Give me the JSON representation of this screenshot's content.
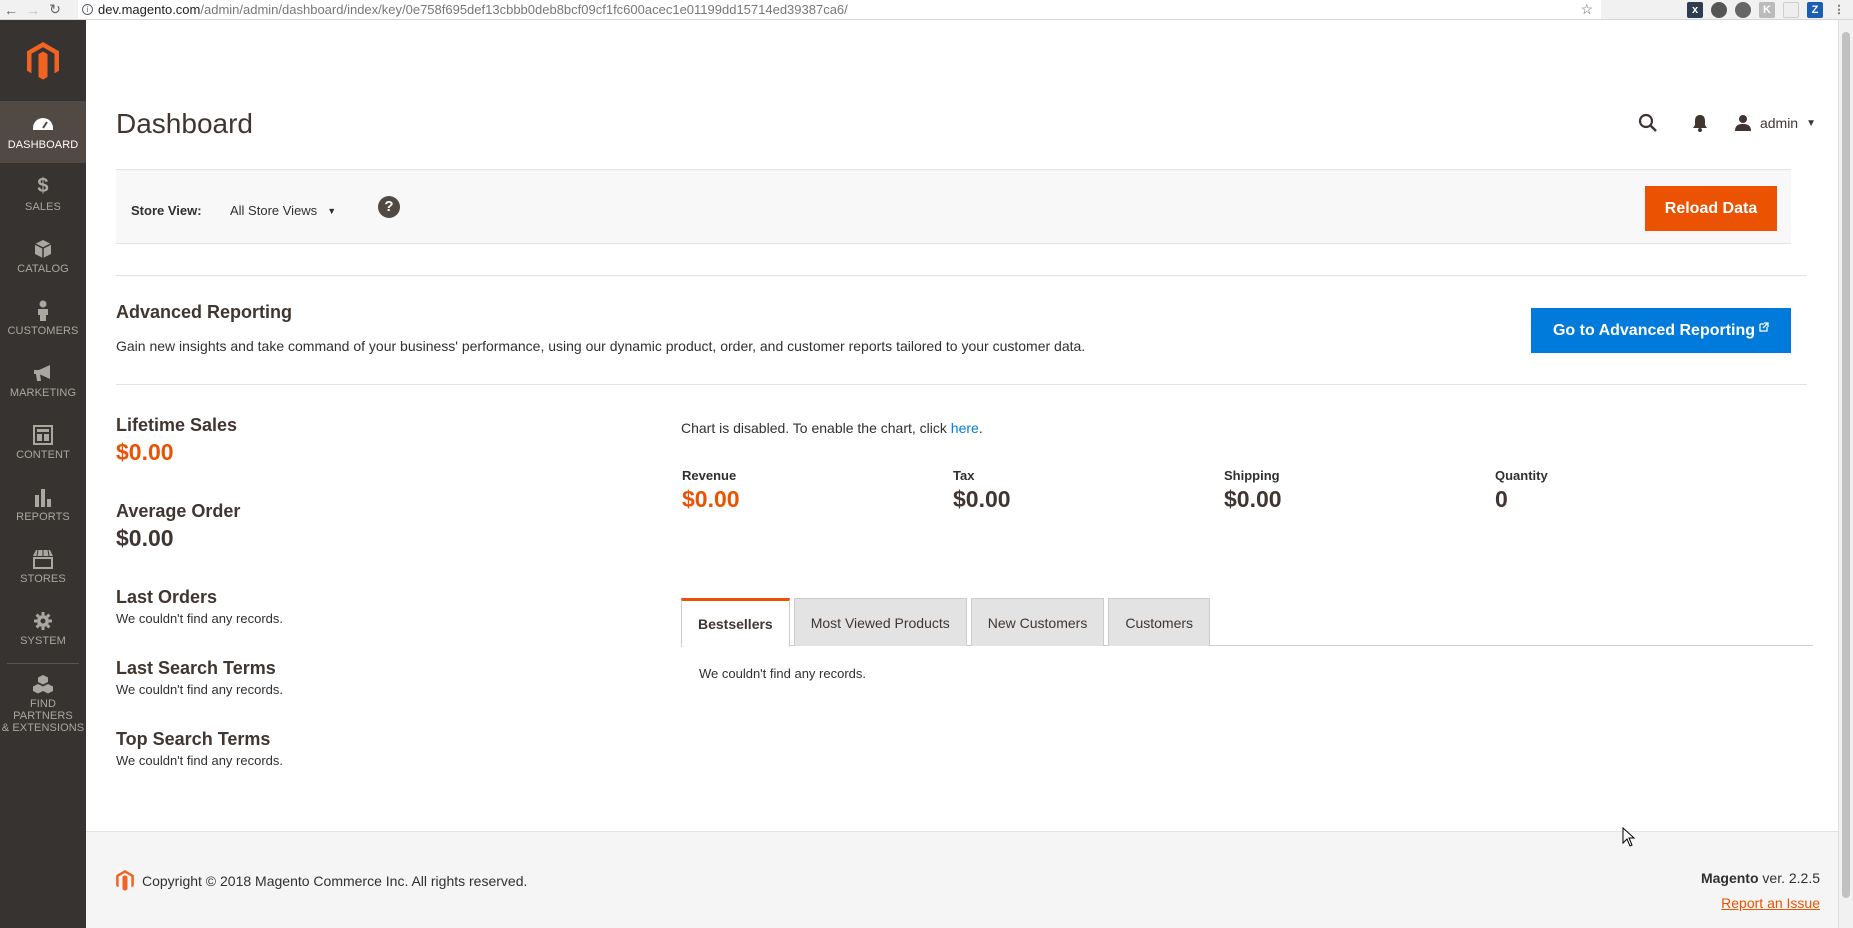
{
  "browser": {
    "url_host": "dev.magento.com",
    "url_path": "/admin/admin/dashboard/index/key/0e758f695def13cbbb0deb8bcf09cf1fc600acec1e01199dd15714ed39387ca6/"
  },
  "sidebar": {
    "items": [
      {
        "label": "DASHBOARD",
        "icon": "dashboard-icon"
      },
      {
        "label": "SALES",
        "icon": "dollar-icon"
      },
      {
        "label": "CATALOG",
        "icon": "box-icon"
      },
      {
        "label": "CUSTOMERS",
        "icon": "person-icon"
      },
      {
        "label": "MARKETING",
        "icon": "megaphone-icon"
      },
      {
        "label": "CONTENT",
        "icon": "layout-icon"
      },
      {
        "label": "REPORTS",
        "icon": "bar-chart-icon"
      },
      {
        "label": "STORES",
        "icon": "store-icon"
      },
      {
        "label": "SYSTEM",
        "icon": "gear-icon"
      },
      {
        "label": "FIND PARTNERS & EXTENSIONS",
        "label_line1": "FIND PARTNERS",
        "label_line2": "& EXTENSIONS",
        "icon": "cubes-icon"
      }
    ]
  },
  "header": {
    "title": "Dashboard",
    "user": "admin"
  },
  "store_bar": {
    "label": "Store View:",
    "selected": "All Store Views",
    "help": "?",
    "reload_label": "Reload Data"
  },
  "advanced": {
    "title": "Advanced Reporting",
    "description": "Gain new insights and take command of your business' performance, using our dynamic product, order, and customer reports tailored to your customer data.",
    "button_label": "Go to Advanced Reporting"
  },
  "stats": {
    "lifetime_sales_label": "Lifetime Sales",
    "lifetime_sales_value": "$0.00",
    "average_order_label": "Average Order",
    "average_order_value": "$0.00",
    "last_orders_label": "Last Orders",
    "last_orders_empty": "We couldn't find any records.",
    "last_search_label": "Last Search Terms",
    "last_search_empty": "We couldn't find any records.",
    "top_search_label": "Top Search Terms",
    "top_search_empty": "We couldn't find any records."
  },
  "chart": {
    "message": "Chart is disabled. To enable the chart, click ",
    "link": "here",
    "period": "."
  },
  "totals": [
    {
      "label": "Revenue",
      "value": "$0.00"
    },
    {
      "label": "Tax",
      "value": "$0.00"
    },
    {
      "label": "Shipping",
      "value": "$0.00"
    },
    {
      "label": "Quantity",
      "value": "0"
    }
  ],
  "tabs": {
    "items": [
      "Bestsellers",
      "Most Viewed Products",
      "New Customers",
      "Customers"
    ],
    "empty": "We couldn't find any records."
  },
  "footer": {
    "copyright": "Copyright © 2018 Magento Commerce Inc. All rights reserved.",
    "brand": "Magento",
    "version": " ver. 2.2.5",
    "report": "Report an Issue"
  },
  "colors": {
    "accent": "#eb5202",
    "link": "#007bdb",
    "sidebar": "#373330"
  }
}
